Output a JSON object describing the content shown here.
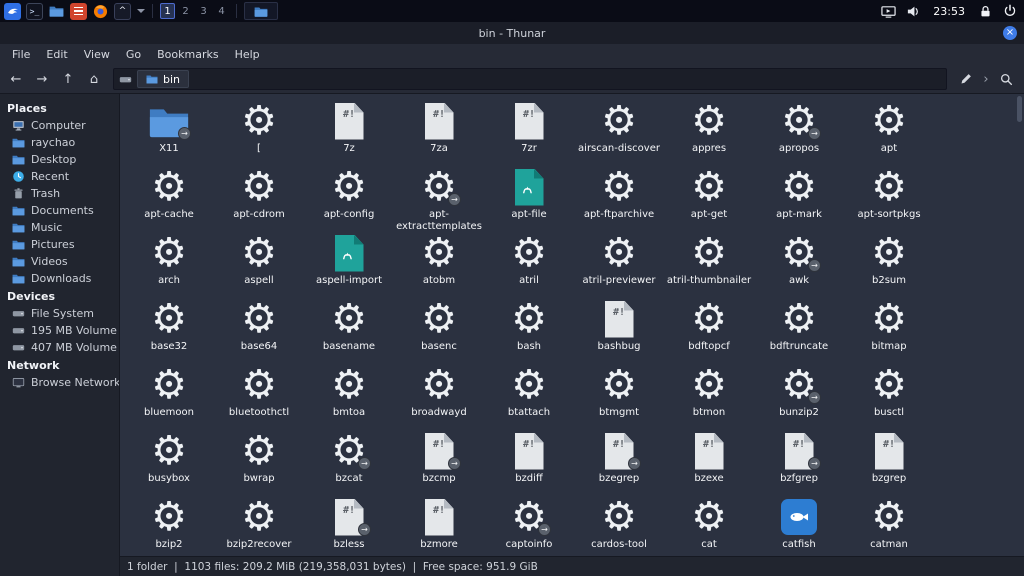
{
  "colors": {
    "accent": "#367bf0",
    "panel_bg": "#0a0c16",
    "main_bg": "#2b3140",
    "sidebar_bg": "#21252f",
    "gear_icon": "#eef1f4",
    "perl_doc_teal": "#1fa39b",
    "catfish_blue": "#2d7dd2"
  },
  "panel": {
    "launchers": [
      {
        "name": "kali-menu"
      },
      {
        "name": "terminal"
      },
      {
        "name": "file-manager"
      },
      {
        "name": "text-editor"
      },
      {
        "name": "firefox"
      },
      {
        "name": "screenshot-tool"
      }
    ],
    "workspaces": {
      "items": [
        "1",
        "2",
        "3",
        "4"
      ],
      "active": 0
    },
    "taskbar_windows": [
      {
        "name": "thunar",
        "icon": "folder"
      }
    ],
    "tray": {
      "time": "23:53"
    }
  },
  "window": {
    "title": "bin - Thunar",
    "menu": [
      "File",
      "Edit",
      "View",
      "Go",
      "Bookmarks",
      "Help"
    ],
    "toolbar": {
      "path_segment": "bin"
    },
    "sidebar": {
      "sections": [
        {
          "header": "Places",
          "items": [
            {
              "label": "Computer",
              "icon": "computer"
            },
            {
              "label": "raychao",
              "icon": "folder"
            },
            {
              "label": "Desktop",
              "icon": "folder"
            },
            {
              "label": "Recent",
              "icon": "clock"
            },
            {
              "label": "Trash",
              "icon": "trash"
            },
            {
              "label": "Documents",
              "icon": "folder"
            },
            {
              "label": "Music",
              "icon": "folder"
            },
            {
              "label": "Pictures",
              "icon": "folder"
            },
            {
              "label": "Videos",
              "icon": "folder"
            },
            {
              "label": "Downloads",
              "icon": "folder"
            }
          ]
        },
        {
          "header": "Devices",
          "items": [
            {
              "label": "File System",
              "icon": "drive"
            },
            {
              "label": "195 MB Volume",
              "icon": "drive"
            },
            {
              "label": "407 MB Volume",
              "icon": "drive"
            }
          ]
        },
        {
          "header": "Network",
          "items": [
            {
              "label": "Browse Network",
              "icon": "network"
            }
          ]
        }
      ]
    },
    "files": {
      "shebang": "#!",
      "items": [
        {
          "label": "X11",
          "type": "folder",
          "symlink": true
        },
        {
          "label": "[",
          "type": "gear"
        },
        {
          "label": "7z",
          "type": "script"
        },
        {
          "label": "7za",
          "type": "script"
        },
        {
          "label": "7zr",
          "type": "script"
        },
        {
          "label": "airscan-discover",
          "type": "gear"
        },
        {
          "label": "appres",
          "type": "gear"
        },
        {
          "label": "apropos",
          "type": "gear",
          "symlink": true
        },
        {
          "label": "apt",
          "type": "gear"
        },
        {
          "label": "apt-cache",
          "type": "gear"
        },
        {
          "label": "apt-cdrom",
          "type": "gear"
        },
        {
          "label": "apt-config",
          "type": "gear"
        },
        {
          "label": "apt-extracttemplates",
          "type": "gear",
          "symlink": true
        },
        {
          "label": "apt-file",
          "type": "perl"
        },
        {
          "label": "apt-ftparchive",
          "type": "gear"
        },
        {
          "label": "apt-get",
          "type": "gear"
        },
        {
          "label": "apt-mark",
          "type": "gear"
        },
        {
          "label": "apt-sortpkgs",
          "type": "gear"
        },
        {
          "label": "arch",
          "type": "gear"
        },
        {
          "label": "aspell",
          "type": "gear"
        },
        {
          "label": "aspell-import",
          "type": "perl"
        },
        {
          "label": "atobm",
          "type": "gear"
        },
        {
          "label": "atril",
          "type": "gear"
        },
        {
          "label": "atril-previewer",
          "type": "gear"
        },
        {
          "label": "atril-thumbnailer",
          "type": "gear"
        },
        {
          "label": "awk",
          "type": "gear",
          "symlink": true
        },
        {
          "label": "b2sum",
          "type": "gear"
        },
        {
          "label": "base32",
          "type": "gear"
        },
        {
          "label": "base64",
          "type": "gear"
        },
        {
          "label": "basename",
          "type": "gear"
        },
        {
          "label": "basenc",
          "type": "gear"
        },
        {
          "label": "bash",
          "type": "gear"
        },
        {
          "label": "bashbug",
          "type": "script"
        },
        {
          "label": "bdftopcf",
          "type": "gear"
        },
        {
          "label": "bdftruncate",
          "type": "gear"
        },
        {
          "label": "bitmap",
          "type": "gear"
        },
        {
          "label": "bluemoon",
          "type": "gear"
        },
        {
          "label": "bluetoothctl",
          "type": "gear"
        },
        {
          "label": "bmtoa",
          "type": "gear"
        },
        {
          "label": "broadwayd",
          "type": "gear"
        },
        {
          "label": "btattach",
          "type": "gear"
        },
        {
          "label": "btmgmt",
          "type": "gear"
        },
        {
          "label": "btmon",
          "type": "gear"
        },
        {
          "label": "bunzip2",
          "type": "gear",
          "symlink": true
        },
        {
          "label": "busctl",
          "type": "gear"
        },
        {
          "label": "busybox",
          "type": "gear"
        },
        {
          "label": "bwrap",
          "type": "gear"
        },
        {
          "label": "bzcat",
          "type": "gear",
          "symlink": true
        },
        {
          "label": "bzcmp",
          "type": "script",
          "symlink": true
        },
        {
          "label": "bzdiff",
          "type": "script"
        },
        {
          "label": "bzegrep",
          "type": "script",
          "symlink": true
        },
        {
          "label": "bzexe",
          "type": "script"
        },
        {
          "label": "bzfgrep",
          "type": "script",
          "symlink": true
        },
        {
          "label": "bzgrep",
          "type": "script"
        },
        {
          "label": "bzip2",
          "type": "gear"
        },
        {
          "label": "bzip2recover",
          "type": "gear"
        },
        {
          "label": "bzless",
          "type": "script",
          "symlink": true
        },
        {
          "label": "bzmore",
          "type": "script"
        },
        {
          "label": "captoinfo",
          "type": "gear",
          "symlink": true
        },
        {
          "label": "cardos-tool",
          "type": "gear"
        },
        {
          "label": "cat",
          "type": "gear"
        },
        {
          "label": "catfish",
          "type": "catfish"
        },
        {
          "label": "catman",
          "type": "gear"
        }
      ]
    },
    "statusbar": "1 folder  |  1103 files: 209.2 MiB (219,358,031 bytes)  |  Free space: 951.9 GiB"
  }
}
